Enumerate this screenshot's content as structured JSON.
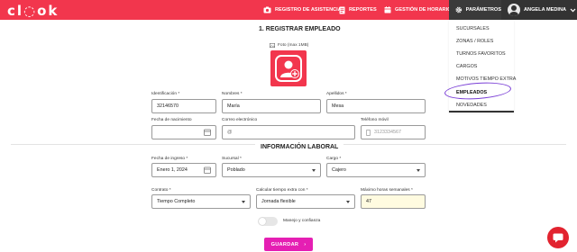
{
  "colors": {
    "brand": "#f2364d",
    "dark": "#333333",
    "save": "#e51fb3",
    "highlight": "#7a3fd6"
  },
  "header": {
    "logo": "cl◌ok",
    "nav": [
      {
        "icon": "camera-icon",
        "label": "REGISTRO DE ASISTENCIA"
      },
      {
        "icon": "document-icon",
        "label": "REPORTES"
      },
      {
        "icon": "calendar-icon",
        "label": "GESTIÓN DE HORARIOS"
      },
      {
        "icon": "gear-icon",
        "label": "PARÁMETROS"
      }
    ],
    "user_name": "ANGELA MEDINA"
  },
  "dropdown": {
    "items": [
      "SUCURSALES",
      "ZONAS / ROLES",
      "TURNOS FAVORITOS",
      "CARGOS",
      "MOTIVOS TIEMPO EXTRA",
      "EMPLEADOS",
      "NOVEDADES"
    ],
    "active": "EMPLEADOS"
  },
  "form": {
    "title": "1. REGISTRAR EMPLEADO",
    "photo_label": "Foto (max 1MB)",
    "fields": {
      "id": {
        "label": "Identificación *",
        "value": "32146570"
      },
      "first_name": {
        "label": "Nombres *",
        "value": "María"
      },
      "last_name": {
        "label": "Apellidos *",
        "value": "Mesa"
      },
      "birth_date": {
        "label": "Fecha de nacimiento",
        "value": ""
      },
      "email": {
        "label": "Correo electrónico",
        "value": ""
      },
      "phone": {
        "label": "Teléfono móvil",
        "placeholder": "3123334567"
      }
    }
  },
  "labor": {
    "title": "INFORMACIÓN LABORAL",
    "fields": {
      "start_date": {
        "label": "Fecha de ingreso *",
        "value": "Enero 1, 2024"
      },
      "branch": {
        "label": "Sucursal *",
        "value": "Poblado"
      },
      "position": {
        "label": "Cargo *",
        "value": "Cajero"
      },
      "contract": {
        "label": "Contrato *",
        "value": "Tiempo Completo"
      },
      "overtime_calc": {
        "label": "Calcular tiempo extra con *",
        "value": "Jornada flexible"
      },
      "max_hours": {
        "label": "Máximo horas semanales *",
        "value": "47"
      }
    },
    "toggle_label": "Manejo y confianza",
    "toggle_on": false
  },
  "save_label": "GUARDAR"
}
